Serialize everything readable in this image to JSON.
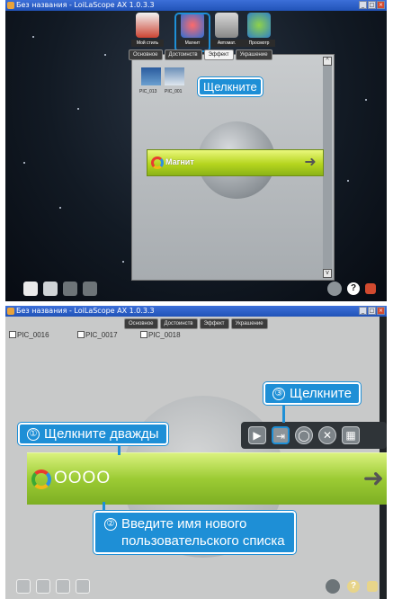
{
  "top_screen": {
    "title": "Без названия - LoiLaScope AX 1.0.3.3",
    "menu_items": [
      "Мой стиль",
      "Магнит",
      "Автомат.",
      "Просмотр"
    ],
    "tabs": [
      "Основное",
      "Достоинств",
      "Эффект",
      "Украшение"
    ],
    "thumbnail_labels": [
      "PIC_013",
      "PIC_001"
    ],
    "list_bar_name": "Магнит",
    "callout": "Щелкните"
  },
  "bottom_screen": {
    "title": "Без названия - LoiLaScope AX 1.0.3.3",
    "tabs": [
      "Основное",
      "Достоинств",
      "Эффект",
      "Украшение"
    ],
    "files": [
      "PIC_0016",
      "PIC_0017",
      "PIC_0018"
    ],
    "list_bar_name": "OOOO",
    "callout_1": {
      "num": "①",
      "text": "Щелкните дважды"
    },
    "callout_2": {
      "num": "②",
      "line1": "Введите имя нового",
      "line2": "пользовательского списка"
    },
    "callout_3": {
      "num": "③",
      "text": "Щелкните"
    },
    "toolbar_icons": [
      "play-icon",
      "import-icon",
      "lasso-icon",
      "close-icon",
      "grid-icon"
    ]
  },
  "colors": {
    "callout_blue": "#1e8fd6",
    "bar_green": "#9ccb34",
    "dark_space": "#121a24"
  }
}
